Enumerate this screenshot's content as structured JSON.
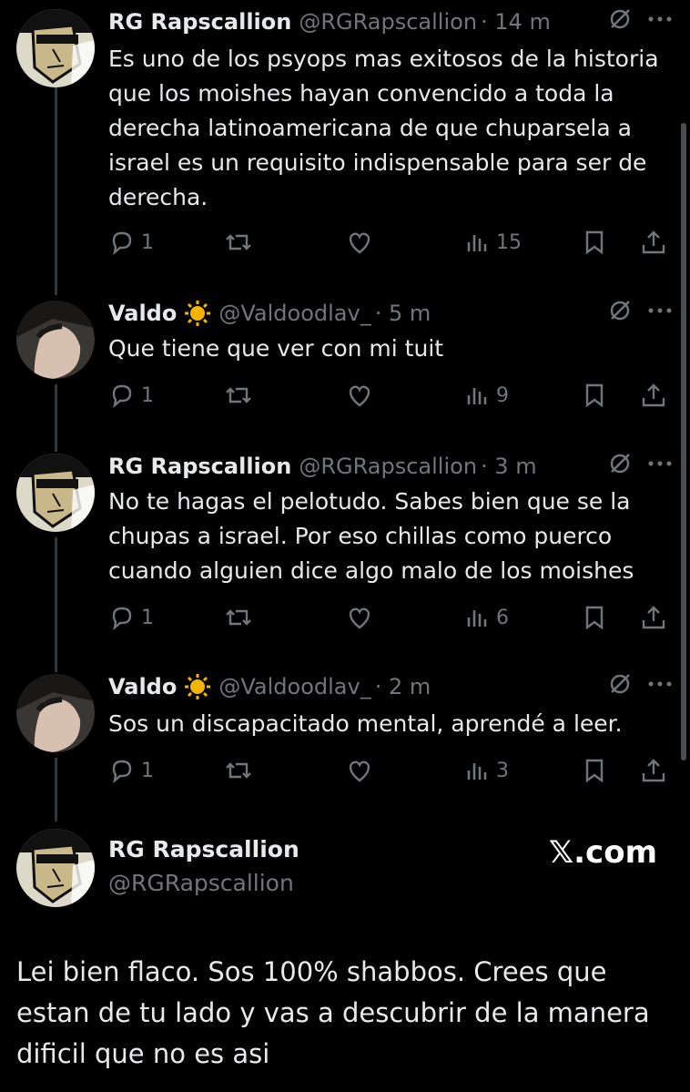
{
  "tweets": [
    {
      "name": "RG Rapscallion",
      "handle": "@RGRapscallion",
      "time": "· 14 m",
      "verified_sun": false,
      "avatar": "rg",
      "text": "Es uno de los psyops mas exitosos de la historia que los moishes hayan convencido a toda la derecha latinoamericana de que chuparsela a israel es un requisito indispensable para ser de derecha.",
      "replies": "1",
      "views": "15"
    },
    {
      "name": "Valdo",
      "handle": "@Valdoodlav_",
      "time": "· 5 m",
      "verified_sun": true,
      "avatar": "valdo",
      "text": "Que tiene que ver con mi tuit",
      "replies": "1",
      "views": "9"
    },
    {
      "name": "RG Rapscallion",
      "handle": "@RGRapscallion",
      "time": "· 3 m",
      "verified_sun": false,
      "avatar": "rg",
      "text": "No te hagas el pelotudo. Sabes bien que se la chupas a israel. Por eso chillas como puerco cuando alguien dice algo malo de los moishes",
      "replies": "1",
      "views": "6"
    },
    {
      "name": "Valdo",
      "handle": "@Valdoodlav_",
      "time": "· 2 m",
      "verified_sun": true,
      "avatar": "valdo",
      "text": "Sos un discapacitado mental, aprendé a leer.",
      "replies": "1",
      "views": "3"
    }
  ],
  "share_card": {
    "name": "RG Rapscallion",
    "handle": "@RGRapscallion",
    "brand": "𝕏.com",
    "text": "Lei bien flaco. Sos 100% shabbos. Crees que estan de tu lado y vas a descubrir de la manera dificil que no es asi"
  },
  "icons": {
    "reply": "reply-icon",
    "retweet": "retweet-icon",
    "like": "heart-icon",
    "views": "views-icon",
    "bookmark": "bookmark-icon",
    "share": "share-icon",
    "grok": "grok-icon",
    "more": "more-icon"
  },
  "colors": {
    "background": "#000000",
    "text": "#e7e9ea",
    "muted": "#71767b",
    "line": "#333639"
  }
}
